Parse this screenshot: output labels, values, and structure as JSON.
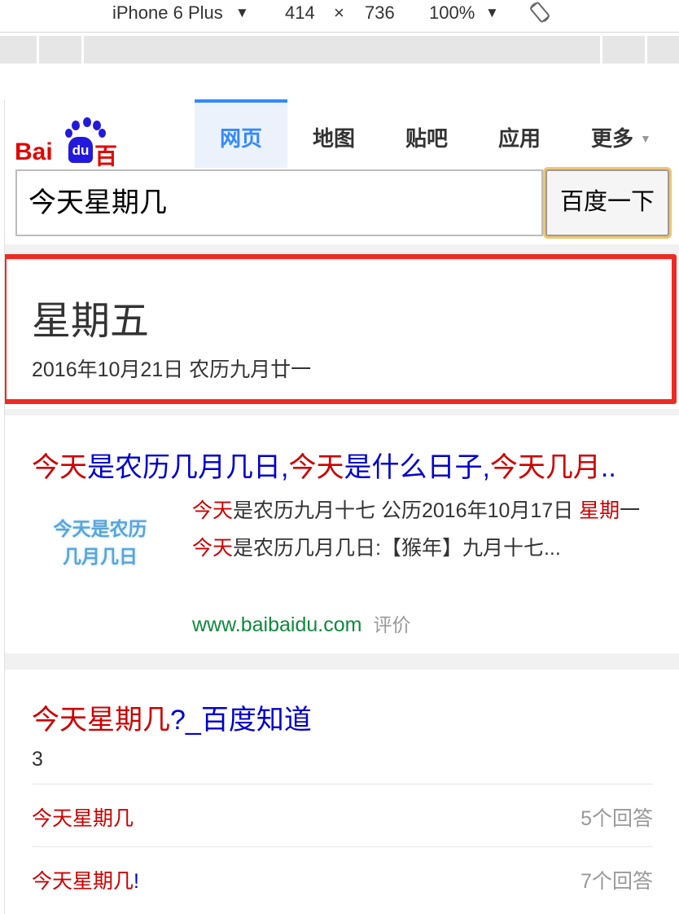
{
  "devtools": {
    "device": "iPhone 6 Plus",
    "width": "414",
    "times": "×",
    "height": "736",
    "zoom": "100%",
    "caret": "▼",
    "rotate_icon": "rotate-icon"
  },
  "logo": {
    "part1": "Bai",
    "part2": "du",
    "part3": "百度"
  },
  "tabs": [
    {
      "label": "网页",
      "active": true
    },
    {
      "label": "地图"
    },
    {
      "label": "贴吧"
    },
    {
      "label": "应用"
    }
  ],
  "more": {
    "label": "更多",
    "caret": "▼"
  },
  "search": {
    "value": "今天星期几",
    "button": "百度一下"
  },
  "answer": {
    "weekday": "星期五",
    "date": "2016年10月21日  农历九月廿一"
  },
  "result1": {
    "title": [
      {
        "t": "今天",
        "c": "red"
      },
      {
        "t": "是农历几月几日,",
        "c": "blue"
      },
      {
        "t": "今天",
        "c": "red"
      },
      {
        "t": "是什么日子,",
        "c": "blue"
      },
      {
        "t": "今天几月",
        "c": "red"
      },
      {
        "t": "..",
        "c": "blue"
      }
    ],
    "thumb_lines": [
      "今天是农历",
      "几月几日"
    ],
    "abstract": [
      {
        "t": "今天",
        "c": "red"
      },
      {
        "t": "是农历九月十七 公历2016年10月17日 ",
        "c": ""
      },
      {
        "t": "星期",
        "c": "red"
      },
      {
        "t": "一 ",
        "c": ""
      },
      {
        "t": "今天",
        "c": "red"
      },
      {
        "t": "是农历几月几日:【猴年】九月十七...",
        "c": ""
      }
    ],
    "url": "www.baibaidu.com",
    "rate": "评价"
  },
  "result2": {
    "title_red": "今天星期几",
    "title_blue": "?_百度知道",
    "count": "3",
    "questions": [
      {
        "q_red": "今天星期几",
        "q_blue": "",
        "answers": "5个回答"
      },
      {
        "q_red": "今天星期几",
        "q_blue": "!",
        "answers": "7个回答"
      }
    ]
  },
  "colors": {
    "accent": "#3388ff",
    "highlight": "#ee2a24",
    "link_red": "#cc0000",
    "link_blue": "#0000cc",
    "url_green": "#11883d"
  }
}
